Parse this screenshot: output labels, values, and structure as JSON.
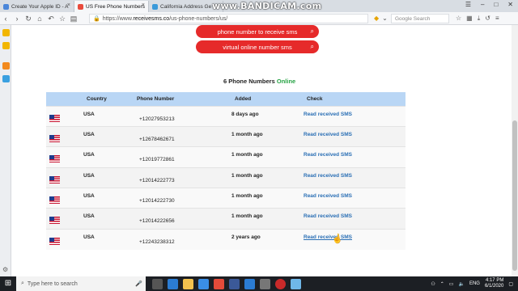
{
  "tabs": [
    {
      "label": "Create Your Apple ID - A",
      "active": false
    },
    {
      "label": "US Free Phone Numbers",
      "active": true
    },
    {
      "label": "California Address Ge",
      "active": false
    }
  ],
  "recording_overlay": "www.BANDICAM.com",
  "address_bar": {
    "scheme": "https://www.",
    "host": "receivesms.co",
    "path": "/us-phone-numbers/us/"
  },
  "search_placeholder": "Google Search",
  "buttons": {
    "receive": "phone number to receive sms",
    "virtual": "virtual online number sms"
  },
  "count": {
    "prefix": "6 Phone Numbers ",
    "highlight": "Online"
  },
  "table": {
    "headers": {
      "country": "Country",
      "phone": "Phone Number",
      "added": "Added",
      "check": "Check"
    },
    "rows": [
      {
        "country": "USA",
        "phone": "+12027953213",
        "added": "8 days ago",
        "check": "Read received SMS"
      },
      {
        "country": "USA",
        "phone": "+12678462671",
        "added": "1 month ago",
        "check": "Read received SMS"
      },
      {
        "country": "USA",
        "phone": "+12019772861",
        "added": "1 month ago",
        "check": "Read received SMS"
      },
      {
        "country": "USA",
        "phone": "+12014222773",
        "added": "1 month ago",
        "check": "Read received SMS"
      },
      {
        "country": "USA",
        "phone": "+12014222730",
        "added": "1 month ago",
        "check": "Read received SMS"
      },
      {
        "country": "USA",
        "phone": "+12014222656",
        "added": "1 month ago",
        "check": "Read received SMS"
      },
      {
        "country": "USA",
        "phone": "+12243238312",
        "added": "2 years ago",
        "check": "Read received SMS"
      }
    ]
  },
  "taskbar": {
    "search_placeholder": "Type here to search",
    "language": "ENG",
    "time": "4:17 PM",
    "date": "6/1/2020"
  },
  "colors": {
    "accent_red": "#e62a2a",
    "online_green": "#27a345",
    "header_blue": "#b9d6f5",
    "link_blue": "#2a6fb5"
  }
}
